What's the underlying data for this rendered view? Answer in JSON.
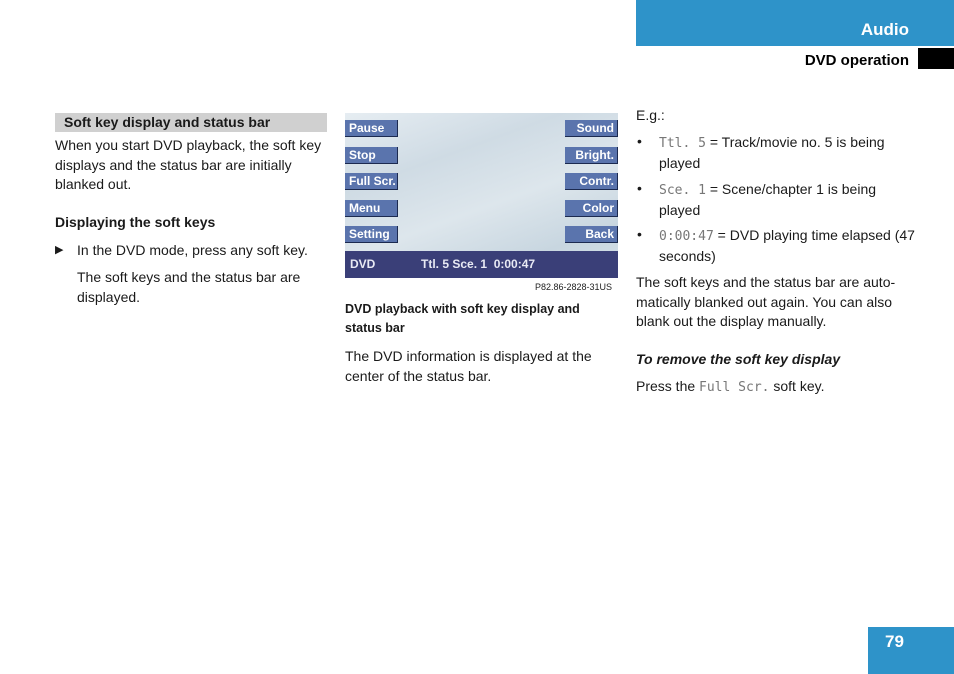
{
  "header": {
    "section": "Audio",
    "subsection": "DVD operation",
    "accent_color": "#2e93c9"
  },
  "left_column": {
    "section_title": "Soft key display and status bar",
    "intro": "When you start DVD playback, the soft key displays and the status bar are initially blanked out.",
    "subheading": "Displaying the soft keys",
    "step_marker": "▶",
    "step": "In the DVD mode, press any soft key.",
    "result": "The soft keys and the status bar are displayed."
  },
  "figure": {
    "left_keys": [
      "Pause",
      "Stop",
      "Full Scr.",
      "Menu",
      "Setting"
    ],
    "right_keys": [
      "Sound",
      "Bright.",
      "Contr.",
      "Color",
      "Back"
    ],
    "status_bar": {
      "mode": "DVD",
      "info": "Ttl. 5 Sce. 1  0:00:47"
    },
    "code": "P82.86-2828-31US",
    "caption": "DVD playback with soft key display and status bar",
    "description": "The DVD information is displayed at the center of the status bar."
  },
  "right_column": {
    "eg_label": "E.g.:",
    "bullets": [
      {
        "code": "Ttl. 5",
        "text": " = Track/movie no. 5 is being played"
      },
      {
        "code": "Sce. 1",
        "text": " = Scene/chapter 1 is being played"
      },
      {
        "code": "0:00:47",
        "text": " = DVD playing time elapsed (47 seconds)"
      }
    ],
    "auto_blank": "The soft keys and the status bar are auto-matically blanked out again. You can also blank out the display manually.",
    "remove_heading": "To remove the soft key display",
    "press_prefix": "Press the ",
    "press_code": "Full Scr.",
    "press_suffix": " soft key."
  },
  "footer": {
    "page_number": "79"
  }
}
